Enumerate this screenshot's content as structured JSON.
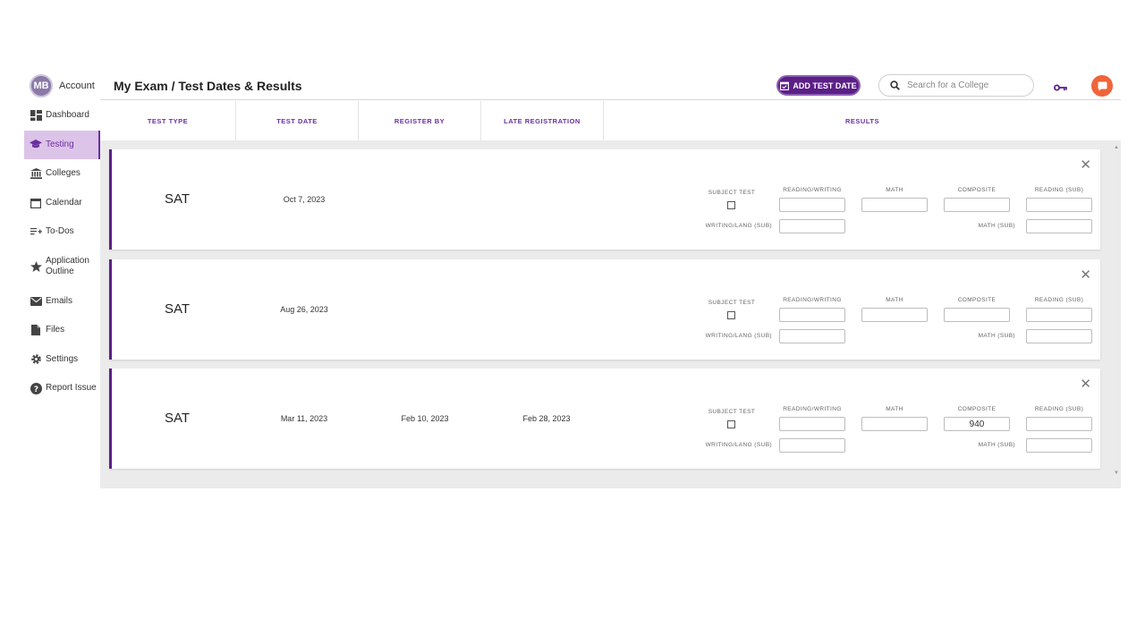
{
  "account": {
    "initials": "MB",
    "label": "Account"
  },
  "sidebar": {
    "items": [
      {
        "label": "Dashboard",
        "icon": "dashboard-icon"
      },
      {
        "label": "Testing",
        "icon": "graduation-cap-icon",
        "active": true
      },
      {
        "label": "Colleges",
        "icon": "institution-icon"
      },
      {
        "label": "Calendar",
        "icon": "calendar-icon"
      },
      {
        "label": "To-Dos",
        "icon": "playlist-add-icon"
      },
      {
        "label": "Application Outline",
        "icon": "star-icon"
      },
      {
        "label": "Emails",
        "icon": "envelope-icon"
      },
      {
        "label": "Files",
        "icon": "file-icon"
      },
      {
        "label": "Settings",
        "icon": "gear-icon"
      },
      {
        "label": "Report Issue",
        "icon": "question-circle-icon"
      }
    ]
  },
  "header": {
    "title": "My Exam / Test Dates & Results",
    "add_button": "ADD TEST DATE",
    "search_placeholder": "Search for a College"
  },
  "columns": {
    "test_type": "TEST TYPE",
    "test_date": "TEST DATE",
    "register_by": "REGISTER BY",
    "late_registration": "LATE REGISTRATION",
    "results": "RESULTS"
  },
  "field_labels": {
    "subject_test": "SUBJECT TEST",
    "reading_writing": "READING/WRITING",
    "math": "MATH",
    "composite": "COMPOSITE",
    "reading_sub": "READING (SUB)",
    "writing_lang_sub": "WRITING/LANG (SUB)",
    "math_sub": "MATH (SUB)"
  },
  "tests": [
    {
      "type": "SAT",
      "test_date": "Oct 7, 2023",
      "register_by": "",
      "late_registration": "",
      "composite": ""
    },
    {
      "type": "SAT",
      "test_date": "Aug 26, 2023",
      "register_by": "",
      "late_registration": "",
      "composite": ""
    },
    {
      "type": "SAT",
      "test_date": "Mar 11, 2023",
      "register_by": "Feb 10, 2023",
      "late_registration": "Feb 28, 2023",
      "composite": "940"
    }
  ],
  "colors": {
    "accent": "#5b1f87",
    "active_bg": "#dcc3e8",
    "chat": "#f0643a"
  }
}
